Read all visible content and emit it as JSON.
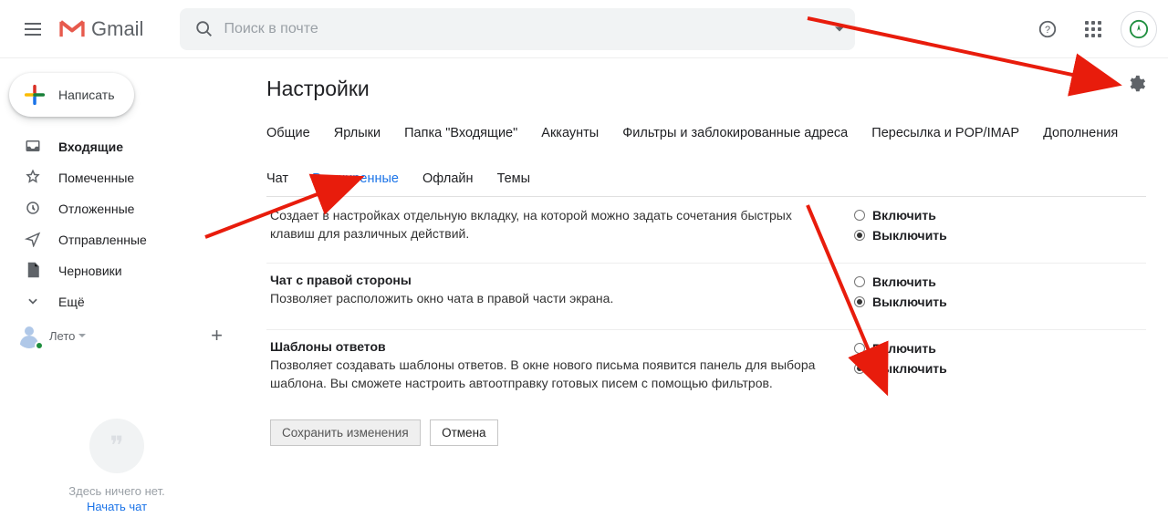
{
  "header": {
    "product": "Gmail",
    "search_placeholder": "Поиск в почте"
  },
  "sidebar": {
    "compose": "Написать",
    "items": [
      {
        "label": "Входящие",
        "icon": "inbox-icon",
        "bold": true
      },
      {
        "label": "Помеченные",
        "icon": "star-icon",
        "bold": false
      },
      {
        "label": "Отложенные",
        "icon": "clock-icon",
        "bold": false
      },
      {
        "label": "Отправленные",
        "icon": "send-icon",
        "bold": false
      },
      {
        "label": "Черновики",
        "icon": "draft-icon",
        "bold": false
      },
      {
        "label": "Ещё",
        "icon": "chevron-down-icon",
        "bold": false
      }
    ],
    "hangouts": {
      "user": "Лето",
      "empty": "Здесь ничего нет.",
      "start": "Начать чат"
    }
  },
  "settings": {
    "title": "Настройки",
    "tabs_row1": [
      "Общие",
      "Ярлыки",
      "Папка \"Входящие\"",
      "Аккаунты",
      "Фильтры и заблокированные адреса",
      "Пересылка и POP/IMAP",
      "Дополнения"
    ],
    "tabs_row2": [
      "Чат",
      "Расширенные",
      "Офлайн",
      "Темы"
    ],
    "active_tab": "Расширенные",
    "options": {
      "enable": "Включить",
      "disable": "Выключить"
    },
    "items": [
      {
        "title": "",
        "desc": "Создает в настройках отдельную вкладку, на которой можно задать сочетания быстрых клавиш для различных действий.",
        "selected": "disable"
      },
      {
        "title": "Чат с правой стороны",
        "desc": "Позволяет расположить окно чата в правой части экрана.",
        "selected": "disable"
      },
      {
        "title": "Шаблоны ответов",
        "desc": "Позволяет создавать шаблоны ответов. В окне нового письма появится панель для выбора шаблона. Вы сможете настроить автоотправку готовых писем с помощью фильтров.",
        "selected": "disable"
      }
    ],
    "buttons": {
      "save": "Сохранить изменения",
      "cancel": "Отмена"
    }
  }
}
